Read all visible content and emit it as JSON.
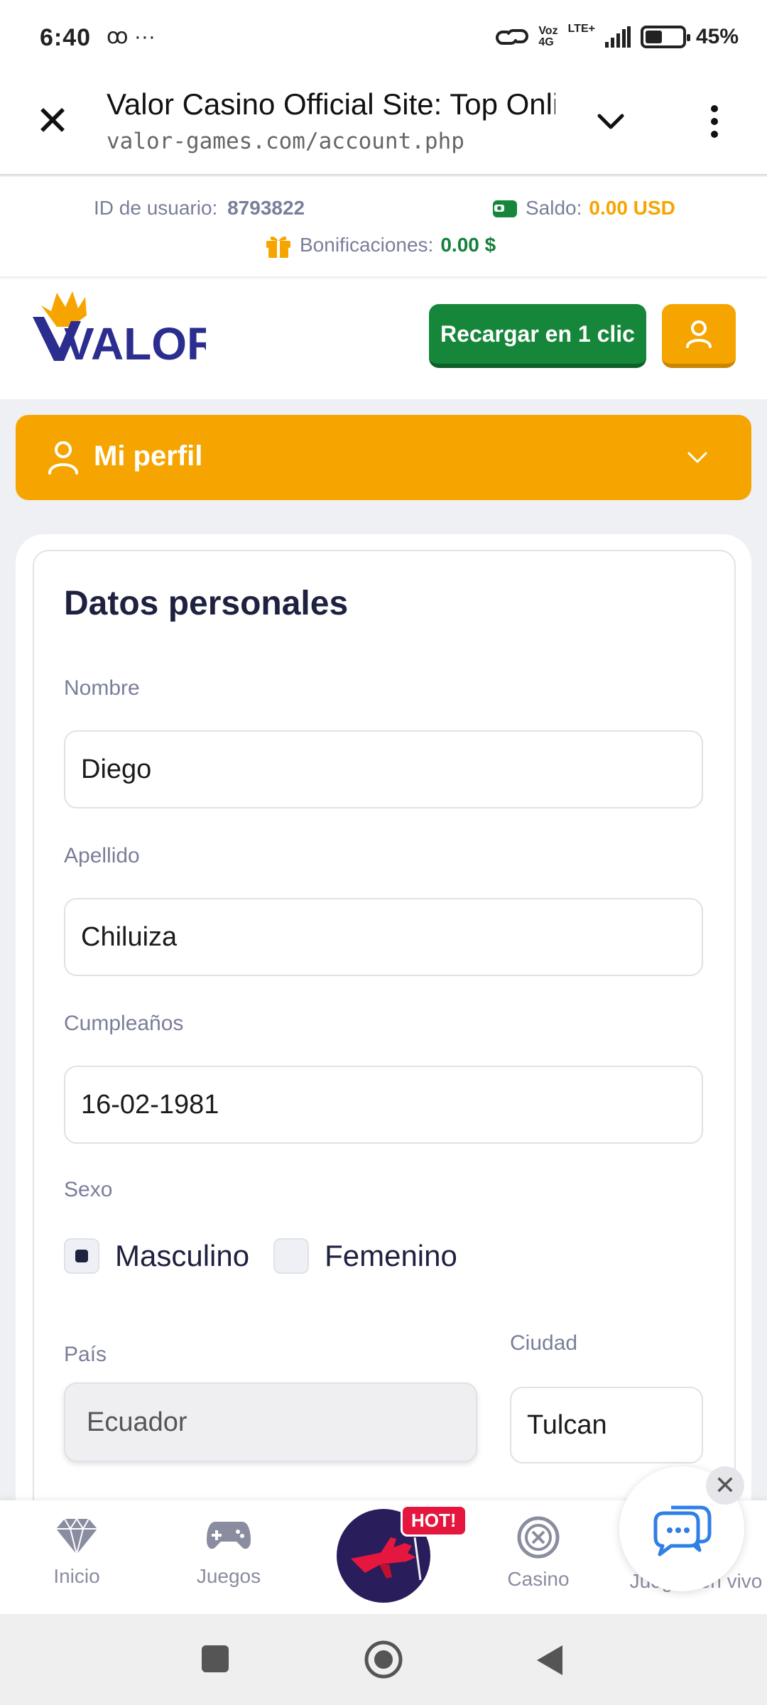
{
  "status_bar": {
    "time": "6:40",
    "left_icons": "ꝏ ···",
    "network_label": "Voz",
    "network_type": "4G",
    "network_lte": "LTE+",
    "battery_pct_label": "45%",
    "battery_level": 0.45
  },
  "browser": {
    "title": "Valor Casino Official Site: Top Online",
    "url": "valor-games.com/account.php"
  },
  "account": {
    "user_id_label": "ID de usuario:",
    "user_id": "8793822",
    "saldo_label": "Saldo:",
    "saldo_value": "0.00 USD",
    "bonus_label": "Bonificaciones:",
    "bonus_value": "0.00 $"
  },
  "header": {
    "logo_text": "VALOR",
    "recharge_label": "Recargar en 1 clic"
  },
  "profile": {
    "label": "Mi perfil"
  },
  "form": {
    "title": "Datos personales",
    "nombre_label": "Nombre",
    "nombre_value": "Diego",
    "apellido_label": "Apellido",
    "apellido_value": "Chiluiza",
    "cumple_label": "Cumpleaños",
    "cumple_value": "16-02-1981",
    "sexo_label": "Sexo",
    "sexo_options": [
      "Masculino",
      "Femenino"
    ],
    "sexo_selected": "Masculino",
    "pais_label": "País",
    "pais_value": "Ecuador",
    "ciudad_label": "Ciudad",
    "ciudad_value": "Tulcan"
  },
  "bottom_nav": {
    "items": [
      "Inicio",
      "Juegos",
      "Casino",
      "Juegos en vivo"
    ],
    "hot_badge": "HOT!"
  },
  "colors": {
    "accent_orange": "#f6a500",
    "green": "#16873a",
    "navy": "#1e2140",
    "logo_blue": "#2b2d8f",
    "hot_red": "#e5173f"
  }
}
